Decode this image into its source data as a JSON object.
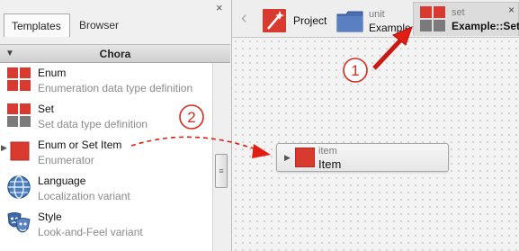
{
  "left_panel": {
    "tabs": [
      {
        "label": "Templates",
        "active": true
      },
      {
        "label": "Browser",
        "active": false
      }
    ],
    "close_glyph": "×",
    "section_title": "Chora",
    "items": [
      {
        "name": "Enum",
        "description": "Enumeration data type definition",
        "icon": "enum-icon"
      },
      {
        "name": "Set",
        "description": "Set data type definition",
        "icon": "set-icon"
      },
      {
        "name": "Enum or Set Item",
        "description": "Enumerator",
        "icon": "item-icon",
        "expandable": true
      },
      {
        "name": "Language",
        "description": "Localization variant",
        "icon": "globe-icon"
      },
      {
        "name": "Style",
        "description": "Look-and-Feel variant",
        "icon": "theatre-masks-icon"
      }
    ]
  },
  "breadcrumbs": [
    {
      "kind": "",
      "label": "Project",
      "icon": "project-wand-icon"
    },
    {
      "kind": "unit",
      "label": "Example",
      "icon": "folder-icon"
    },
    {
      "kind": "set",
      "label": "Example::Set",
      "icon": "set-icon",
      "active": true
    }
  ],
  "canvas": {
    "node": {
      "kind": "item",
      "label": "Item",
      "icon": "item-icon"
    }
  },
  "callouts": [
    "1",
    "2"
  ],
  "colors": {
    "accent_red": "#d93a30",
    "arrow_red": "#e01e14",
    "folder_blue": "#4a6fb0"
  }
}
